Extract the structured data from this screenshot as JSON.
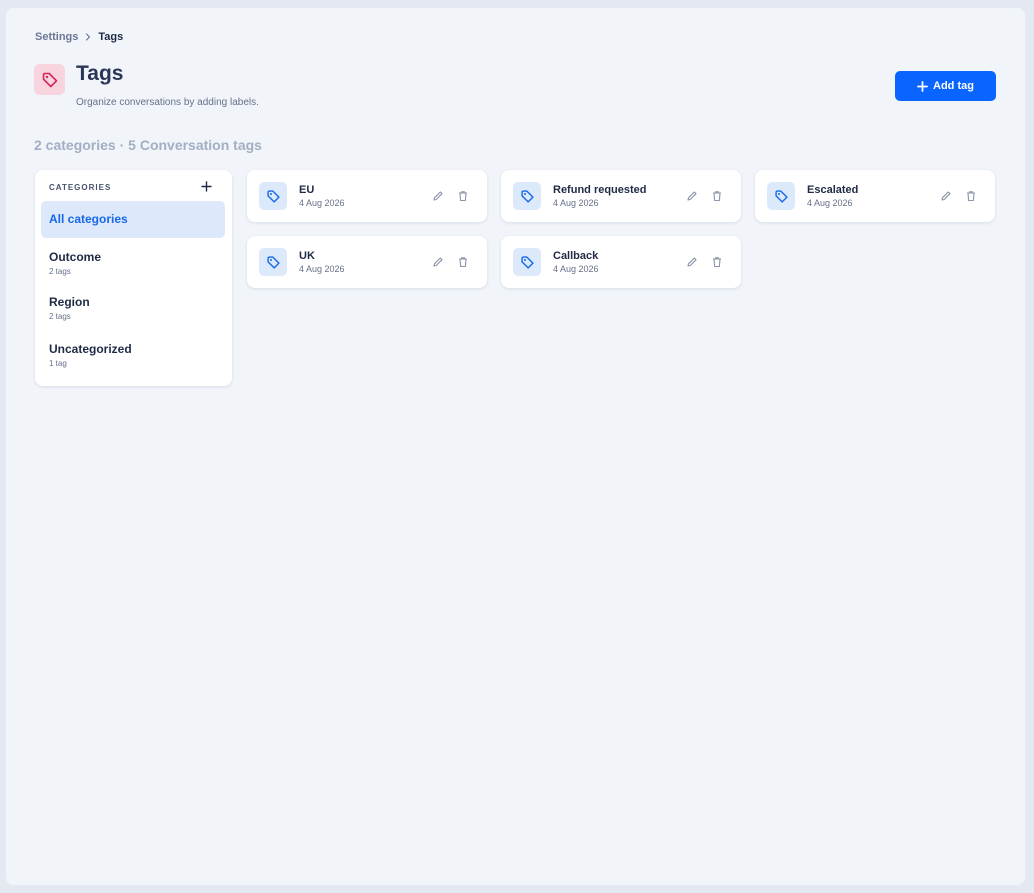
{
  "breadcrumb": {
    "parent": "Settings",
    "current": "Tags"
  },
  "header": {
    "title": "Tags",
    "subtitle": "Organize conversations by adding labels.",
    "add_button_label": "Add tag"
  },
  "summary": "2 categories · 5 Conversation tags",
  "categories": {
    "header": "CATEGORIES",
    "items": [
      {
        "name": "All categories",
        "count": "",
        "active": true
      },
      {
        "name": "Outcome",
        "count": "2 tags"
      },
      {
        "name": "Region",
        "count": "2 tags"
      },
      {
        "name": "Uncategorized",
        "count": "1 tag"
      }
    ]
  },
  "tags": [
    {
      "name": "EU",
      "date": "4 Aug 2026"
    },
    {
      "name": "Refund requested",
      "date": "4 Aug 2026"
    },
    {
      "name": "Escalated",
      "date": "4 Aug 2026"
    },
    {
      "name": "UK",
      "date": "4 Aug 2026"
    },
    {
      "name": "Callback",
      "date": "4 Aug 2026"
    }
  ],
  "icons": {
    "title_icon": "tag-icon",
    "tag_icon": "tag-icon",
    "edit_icon": "pencil-icon",
    "delete_icon": "trash-icon",
    "add_icon": "plus-icon",
    "breadcrumb_separator": "chevron-right-icon"
  },
  "colors": {
    "accent": "#0a64ff",
    "title_icon_bg": "#f8d4de",
    "title_icon_stroke": "#d6265a",
    "tag_icon_bg": "#dce9fb",
    "tag_icon_stroke": "#1768e8",
    "active_category_bg": "#dde9fa"
  }
}
